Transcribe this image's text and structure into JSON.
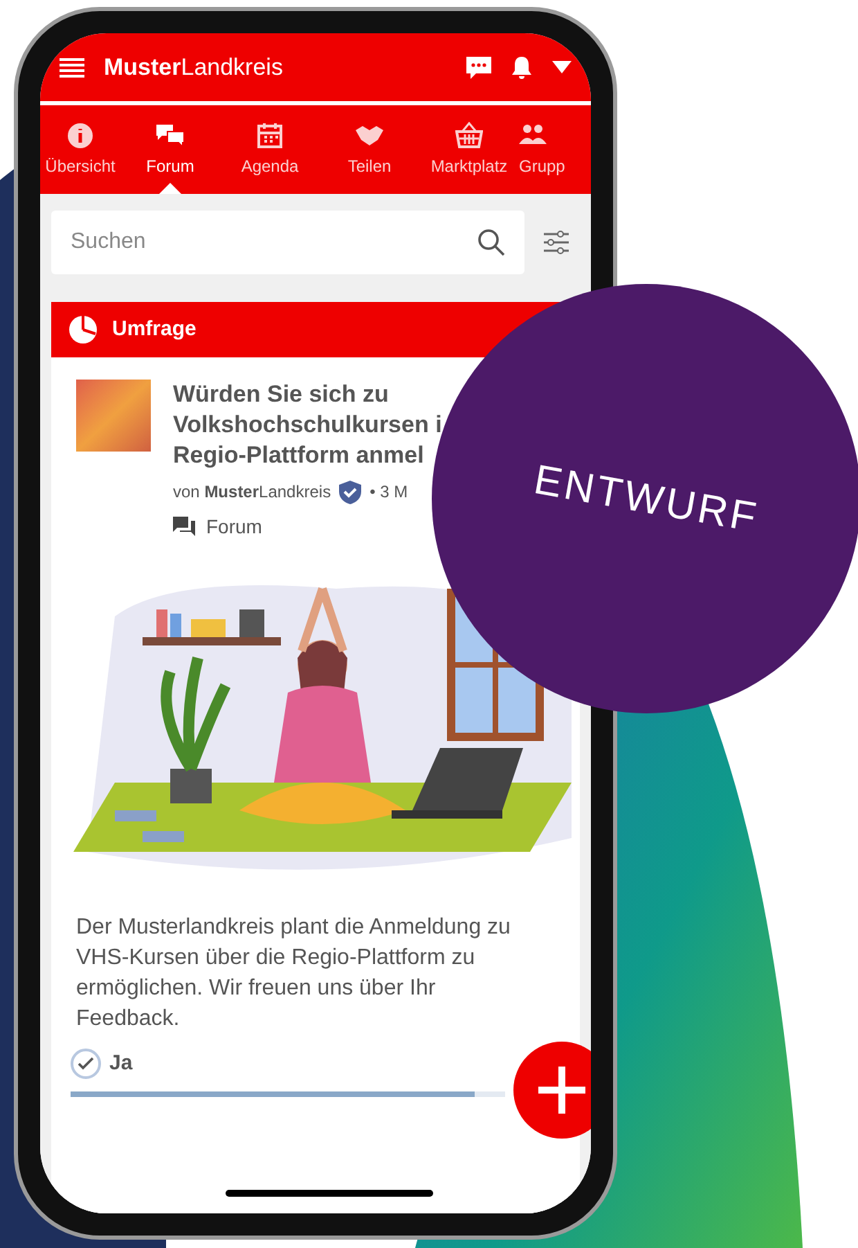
{
  "app_bar": {
    "title_bold": "Muster",
    "title_rest": "Landkreis"
  },
  "tabs": [
    {
      "label": "Übersicht",
      "selected": false
    },
    {
      "label": "Forum",
      "selected": true
    },
    {
      "label": "Agenda",
      "selected": false
    },
    {
      "label": "Teilen",
      "selected": false
    },
    {
      "label": "Marktplatz",
      "selected": false
    },
    {
      "label": "Grupp",
      "selected": false
    }
  ],
  "search": {
    "placeholder": "Suchen"
  },
  "post": {
    "category": "Umfrage",
    "title_lines": [
      "Würden Sie sich zu",
      "Volkshochschulkursen i",
      "Regio-Plattform anmel"
    ],
    "author_prefix": "von",
    "author_bold": "Muster",
    "author_rest": "Landkreis",
    "verified": true,
    "time": "• 3 M",
    "board": "Forum",
    "description": "Der Musterlandkreis plant die Anmeldung zu VHS-Kursen über die Regio-Plattform zu ermöglichen. Wir freuen uns über Ihr Feedback.",
    "options": [
      {
        "label": "Ja",
        "checked": true,
        "level": 0.93
      }
    ]
  },
  "badge": {
    "text": "ENTWURF"
  }
}
